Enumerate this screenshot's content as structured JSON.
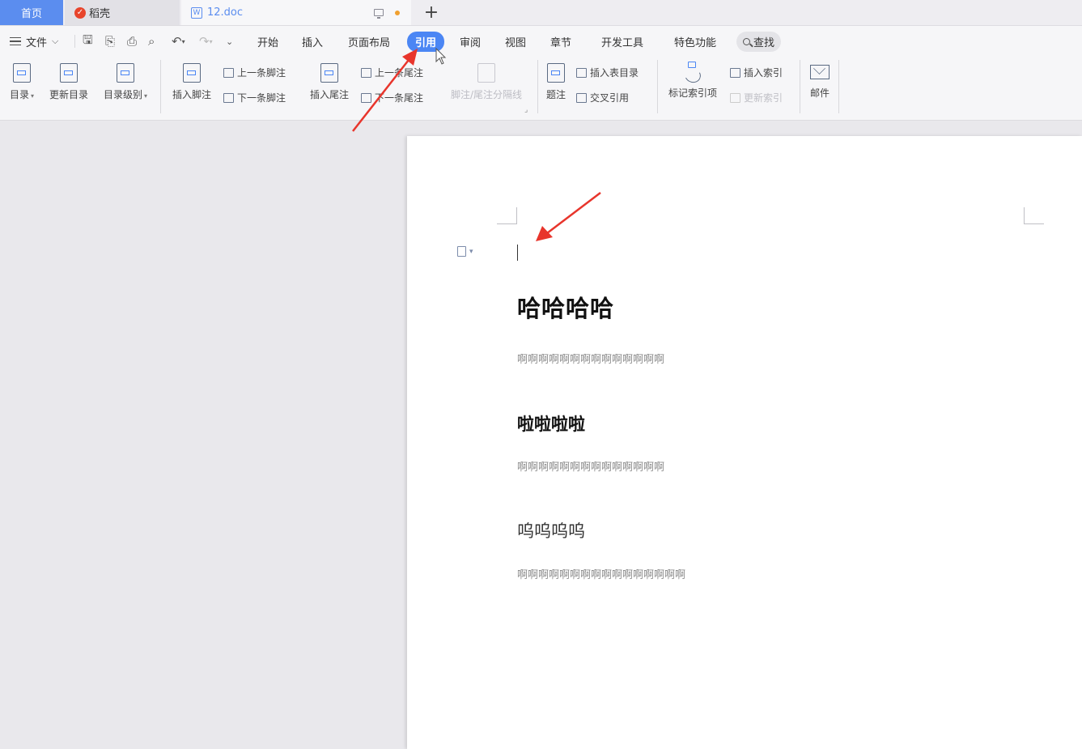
{
  "tabs": {
    "home": "首页",
    "daoke": "稻壳",
    "doc": "12.doc",
    "new_tab": "+"
  },
  "menu": {
    "file": "文件",
    "tabs": [
      "开始",
      "插入",
      "页面布局",
      "引用",
      "审阅",
      "视图",
      "章节",
      "开发工具",
      "特色功能"
    ],
    "active_tab": "引用",
    "search": "查找"
  },
  "ribbon": {
    "toc": "目录",
    "update_toc": "更新目录",
    "toc_level": "目录级别",
    "insert_footnote": "插入脚注",
    "prev_footnote": "上一条脚注",
    "next_footnote": "下一条脚注",
    "insert_endnote": "插入尾注",
    "prev_endnote": "上一条尾注",
    "next_endnote": "下一条尾注",
    "separator": "脚注/尾注分隔线",
    "caption": "题注",
    "insert_table_of_figures": "插入表目录",
    "cross_reference": "交叉引用",
    "mark_index_entry": "标记索引项",
    "insert_index": "插入索引",
    "update_index": "更新索引",
    "mail": "邮件"
  },
  "document": {
    "heading1": "哈哈哈哈",
    "body1": "啊啊啊啊啊啊啊啊啊啊啊啊啊啊",
    "heading2": "啦啦啦啦",
    "body2": "啊啊啊啊啊啊啊啊啊啊啊啊啊啊",
    "heading3": "呜呜呜呜",
    "body3": "啊啊啊啊啊啊啊啊啊啊啊啊啊啊啊啊"
  },
  "colors": {
    "accent": "#4b86f4",
    "annotation_arrow": "#e8352c"
  }
}
